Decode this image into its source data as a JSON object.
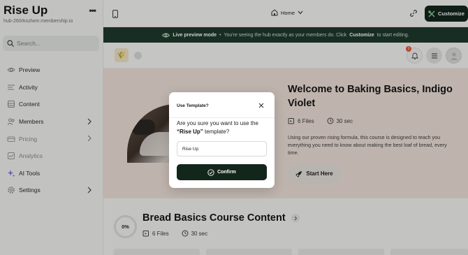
{
  "sidebar": {
    "brand_title": "Rise Up",
    "brand_url": "hub-260rknzlwm.membership.io",
    "search_placeholder": "Search...",
    "items": [
      {
        "label": "Preview",
        "icon": "eye-icon"
      },
      {
        "label": "Activity",
        "icon": "activity-icon"
      },
      {
        "label": "Content",
        "icon": "content-icon"
      },
      {
        "label": "Members",
        "icon": "members-icon"
      },
      {
        "label": "Pricing",
        "icon": "pricing-icon"
      },
      {
        "label": "Analytics",
        "icon": "analytics-icon"
      },
      {
        "label": "AI Tools",
        "icon": "sparkle-icon"
      },
      {
        "label": "Settings",
        "icon": "gear-icon"
      }
    ]
  },
  "topbar": {
    "page_selector": "Home",
    "customize_label": "Customize"
  },
  "preview_bar": {
    "mode_label": "Live preview mode",
    "separator": "•",
    "message_prefix": "You're seeing the hub exactly as your members do. Click",
    "message_link": "Customize",
    "message_suffix": "to start editing."
  },
  "hub_header": {
    "notification_count": "1"
  },
  "hero": {
    "title": "Welcome to Baking Basics, Indigo Violet",
    "files": "6 Files",
    "duration": "30 sec",
    "description": "Using our proven rising formula, this course is designed to teach you everything you need to know about making the best loaf of bread, every time.",
    "cta_label": "Start Here"
  },
  "course": {
    "progress": "0%",
    "title": "Bread Basics Course Content",
    "files": "6 Files",
    "duration": "30 sec"
  },
  "modal": {
    "title": "Use Template?",
    "question_prefix": "Are you sure you want to use the",
    "template_name": "“Rise Up”",
    "question_suffix": "template?",
    "input_value": "Rise Up",
    "confirm_label": "Confirm"
  },
  "colors": {
    "brand_dark": "#13261c",
    "preview_bar": "#1e3a2c",
    "hero_bg": "#efe1d9",
    "badge": "#e15b3d"
  }
}
